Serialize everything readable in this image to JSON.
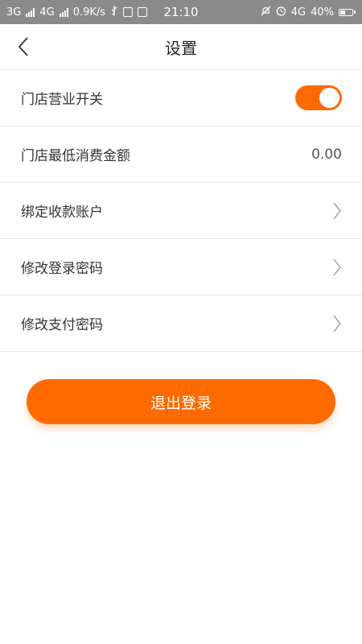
{
  "status_bar": {
    "network1": "3G",
    "network2": "4G",
    "speed": "0.9K/s",
    "time": "21:10",
    "network3": "4G",
    "battery": "40%",
    "bg_color": "#8a8a8a"
  },
  "header": {
    "title": "设置"
  },
  "settings": {
    "store_open_label": "门店营业开关",
    "store_open_on": true,
    "min_spend_label": "门店最低消费金额",
    "min_spend_value": "0.00",
    "bind_account_label": "绑定收款账户",
    "change_login_pwd_label": "修改登录密码",
    "change_pay_pwd_label": "修改支付密码"
  },
  "logout_label": "退出登录",
  "colors": {
    "accent": "#ff6a00"
  }
}
